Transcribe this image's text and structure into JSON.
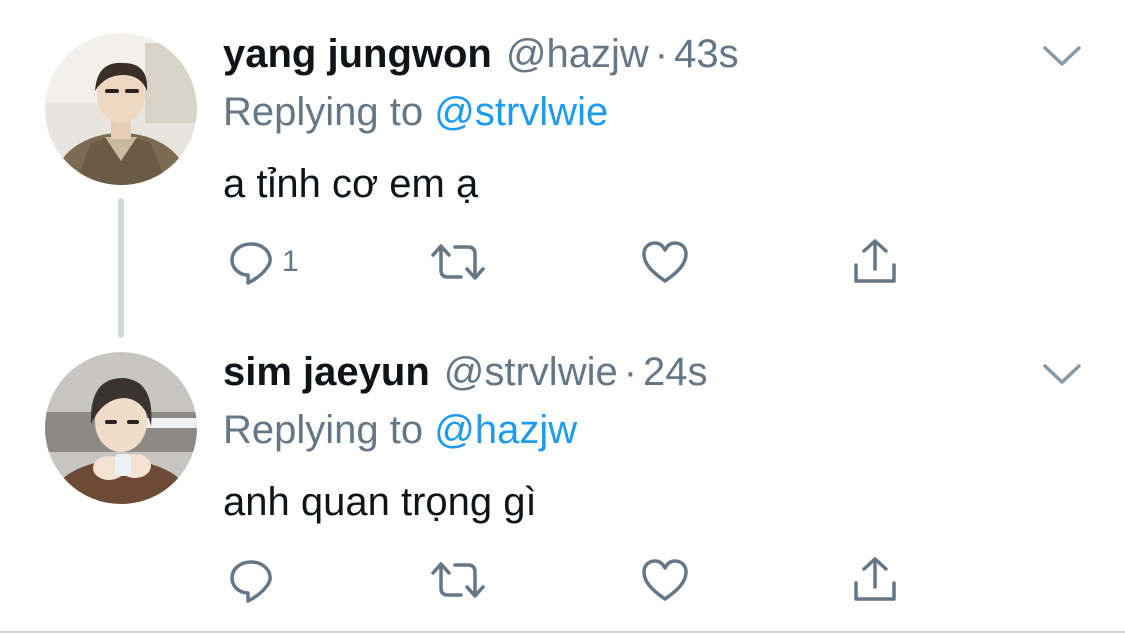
{
  "tweets": [
    {
      "name": "yang jungwon",
      "handle": "@hazjw",
      "separator": "·",
      "time": "43s",
      "replying_prefix": "Replying to",
      "replying_handle": "@strvlwie",
      "text": "a tỉnh cơ em ạ",
      "reply_count": "1",
      "avatar_icon": "avatar-photo",
      "menu_icon": "chevron-down-icon"
    },
    {
      "name": "sim jaeyun",
      "handle": "@strvlwie",
      "separator": "·",
      "time": "24s",
      "replying_prefix": "Replying to",
      "replying_handle": "@hazjw",
      "text": "anh quan trọng gì",
      "reply_count": "",
      "avatar_icon": "avatar-photo",
      "menu_icon": "chevron-down-icon"
    }
  ],
  "colors": {
    "text_primary": "#0f1419",
    "text_secondary": "#657786",
    "accent": "#1d9bf0",
    "thread_line": "#cfd9de"
  }
}
